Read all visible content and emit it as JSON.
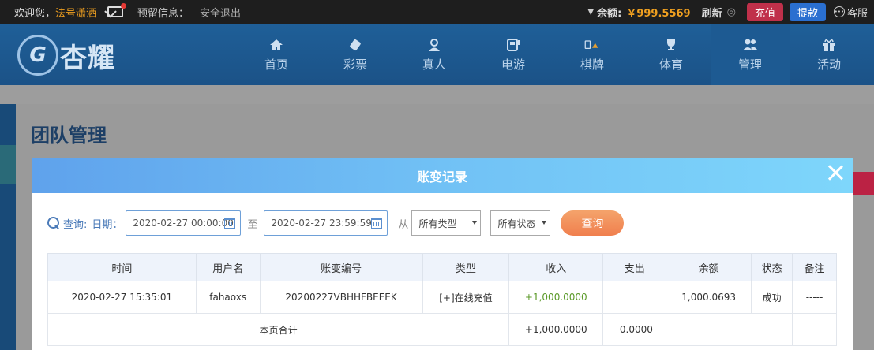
{
  "topbar": {
    "welcome": "欢迎您，",
    "username": "法号潇洒",
    "reserved_info": "预留信息：",
    "logout": "安全退出",
    "balance_label": "余额:",
    "balance": "￥999.5569",
    "refresh": "刷新",
    "recharge": "充值",
    "withdraw": "提款",
    "service": "客服"
  },
  "logo": {
    "mark": "G",
    "text": "杏耀"
  },
  "nav": [
    {
      "label": "首页",
      "icon": "home-icon"
    },
    {
      "label": "彩票",
      "icon": "lottery-icon"
    },
    {
      "label": "真人",
      "icon": "live-dealer-icon"
    },
    {
      "label": "电游",
      "icon": "slot-machine-icon"
    },
    {
      "label": "棋牌",
      "icon": "cards-icon"
    },
    {
      "label": "体育",
      "icon": "trophy-icon"
    },
    {
      "label": "管理",
      "icon": "users-icon"
    },
    {
      "label": "活动",
      "icon": "gift-icon"
    }
  ],
  "page": {
    "title": "团队管理"
  },
  "modal": {
    "title": "账变记录",
    "filter": {
      "query_label": "查询:",
      "date_label": "日期：",
      "start": "2020-02-27 00:00:00",
      "to_label": "至",
      "end": "2020-02-27 23:59:59",
      "from_label": "从",
      "type_select": "所有类型",
      "status_select": "所有状态",
      "query_button": "查询"
    },
    "table": {
      "headers": [
        "时间",
        "用户名",
        "账变编号",
        "类型",
        "收入",
        "支出",
        "余额",
        "状态",
        "备注"
      ],
      "row": {
        "time": "2020-02-27 15:35:01",
        "user": "fahaoxs",
        "id": "20200227VBHHFBEEEK",
        "type": "[+]在线充值",
        "income": "+1,000.0000",
        "expense": "",
        "balance": "1,000.0693",
        "status": "成功",
        "note": "-----"
      },
      "total": {
        "label": "本页合计",
        "income": "+1,000.0000",
        "expense": "-0.0000",
        "rest": "--"
      }
    }
  },
  "colors": {
    "accent": "#f07f4e",
    "brand": "#1d5a92",
    "income": "#5c9a2a"
  }
}
